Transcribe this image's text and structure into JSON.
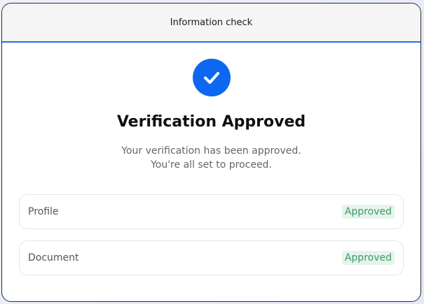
{
  "window": {
    "title": "Information check"
  },
  "status": {
    "icon": "check-circle-icon",
    "headline": "Verification Approved",
    "description_line1": "Your verification has been approved.",
    "description_line2": "You're all set to proceed."
  },
  "checks": [
    {
      "label": "Profile",
      "status": "Approved"
    },
    {
      "label": "Document",
      "status": "Approved"
    }
  ],
  "colors": {
    "accent": "#0e67f0",
    "success_text": "#3b9b65",
    "success_bg": "#e6f4ec"
  }
}
